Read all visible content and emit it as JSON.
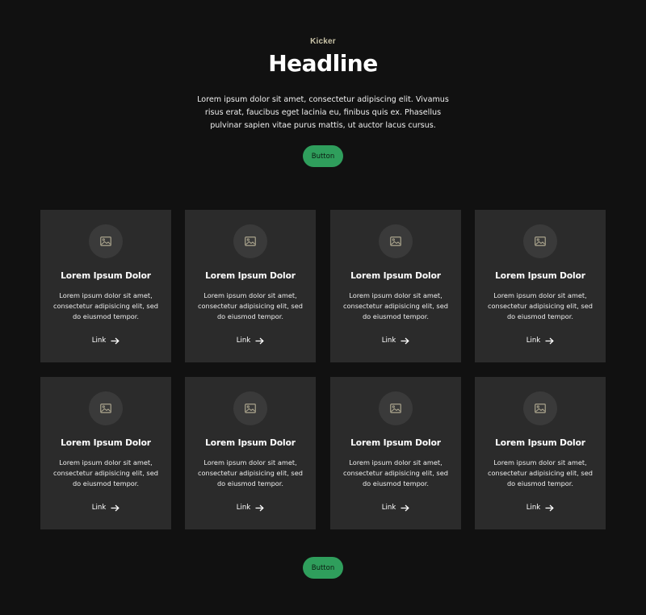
{
  "hero": {
    "kicker": "Kicker",
    "headline": "Headline",
    "intro": "Lorem ipsum dolor sit amet, consectetur adipiscing elit. Vivamus risus erat, faucibus eget lacinia eu, finibus quis ex. Phasellus pulvinar sapien vitae purus mattis, ut auctor lacus cursus.",
    "button_label": "Button"
  },
  "cards": [
    {
      "icon": "image-icon",
      "title": "Lorem Ipsum Dolor",
      "body": "Lorem ipsum dolor sit amet, consectetur adipisicing elit, sed do eiusmod tempor.",
      "link": "Link"
    },
    {
      "icon": "image-icon",
      "title": "Lorem Ipsum Dolor",
      "body": "Lorem ipsum dolor sit amet, consectetur adipisicing elit, sed do eiusmod tempor.",
      "link": "Link"
    },
    {
      "icon": "image-icon",
      "title": "Lorem Ipsum Dolor",
      "body": "Lorem ipsum dolor sit amet, consectetur adipisicing elit, sed do eiusmod tempor.",
      "link": "Link"
    },
    {
      "icon": "image-icon",
      "title": "Lorem Ipsum Dolor",
      "body": "Lorem ipsum dolor sit amet, consectetur adipisicing elit, sed do eiusmod tempor.",
      "link": "Link"
    },
    {
      "icon": "image-icon",
      "title": "Lorem Ipsum Dolor",
      "body": "Lorem ipsum dolor sit amet, consectetur adipisicing elit, sed do eiusmod tempor.",
      "link": "Link"
    },
    {
      "icon": "image-icon",
      "title": "Lorem Ipsum Dolor",
      "body": "Lorem ipsum dolor sit amet, consectetur adipisicing elit, sed do eiusmod tempor.",
      "link": "Link"
    },
    {
      "icon": "image-icon",
      "title": "Lorem Ipsum Dolor",
      "body": "Lorem ipsum dolor sit amet, consectetur adipisicing elit, sed do eiusmod tempor.",
      "link": "Link"
    },
    {
      "icon": "image-icon",
      "title": "Lorem Ipsum Dolor",
      "body": "Lorem ipsum dolor sit amet, consectetur adipisicing elit, sed do eiusmod tempor.",
      "link": "Link"
    }
  ],
  "footer": {
    "button_label": "Button"
  },
  "colors": {
    "background": "#111111",
    "card": "#2b2b2b",
    "accent": "#2f9e5c",
    "kicker": "#c9c3a7"
  }
}
